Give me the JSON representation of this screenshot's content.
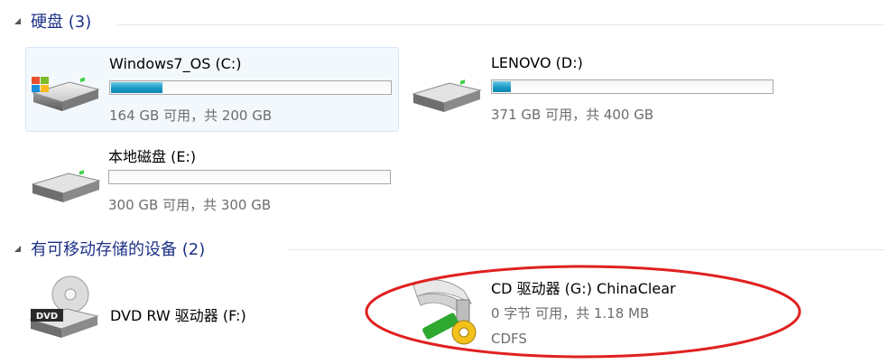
{
  "groups": {
    "hard_disks": {
      "title": "硬盘 (3)"
    },
    "removable": {
      "title": "有可移动存储的设备 (2)"
    }
  },
  "drives": [
    {
      "name": "Windows7_OS (C:)",
      "space": "164 GB 可用，共 200 GB",
      "used_fraction": 0.18,
      "icon": "windows-drive-icon"
    },
    {
      "name": "LENOVO (D:)",
      "space": "371 GB 可用，共 400 GB",
      "used_fraction": 0.07,
      "icon": "hard-drive-icon"
    },
    {
      "name": "本地磁盘 (E:)",
      "space": "300 GB 可用，共 300 GB",
      "used_fraction": 0.0,
      "icon": "hard-drive-icon"
    }
  ],
  "removable": [
    {
      "name": "DVD RW 驱动器 (F:)",
      "icon": "dvd-drive-icon",
      "badge": "DVD"
    },
    {
      "name": "CD 驱动器 (G:) ChinaClear",
      "space": "0 字节 可用，共 1.18 MB",
      "fs": "CDFS",
      "icon": "cd-autorun-icon"
    }
  ],
  "colors": {
    "group_title": "#1e3287",
    "bar_fill": "#1a9ac6",
    "annotation": "#e02020"
  }
}
